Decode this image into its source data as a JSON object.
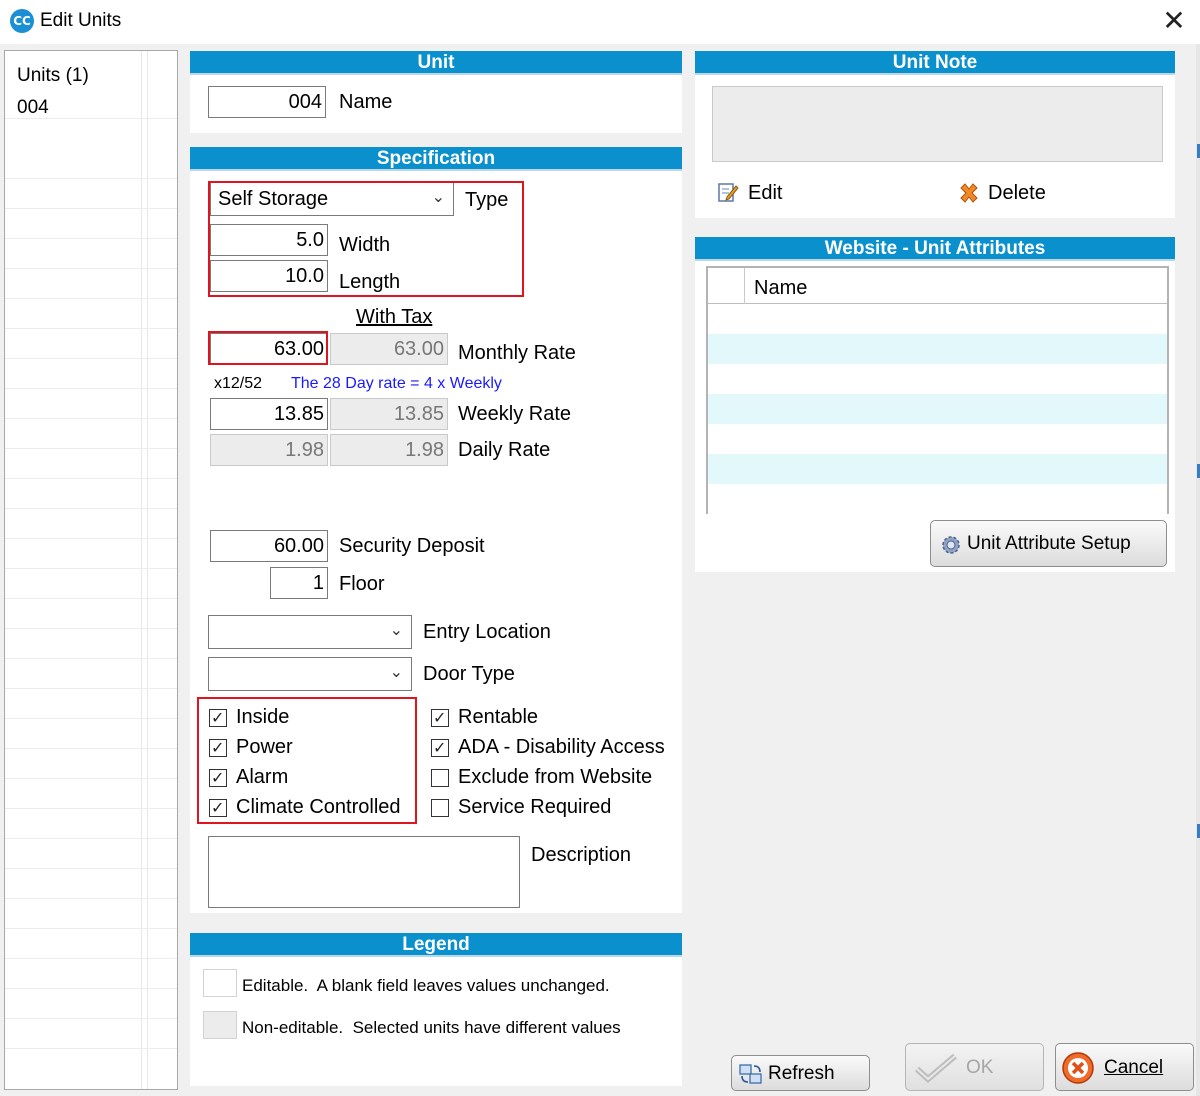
{
  "window": {
    "title": "Edit Units",
    "app_icon_text": "CC"
  },
  "units_list": {
    "header": "Units (1)",
    "items": [
      "004"
    ]
  },
  "unit_panel": {
    "title": "Unit",
    "name_value": "004",
    "name_label": "Name"
  },
  "specification": {
    "title": "Specification",
    "type_value": "Self Storage",
    "type_label": "Type",
    "width_value": "5.0",
    "width_label": "Width",
    "length_value": "10.0",
    "length_label": "Length",
    "with_tax_header": "With Tax",
    "monthly_rate_value": "63.00",
    "monthly_rate_tax_value": "63.00",
    "monthly_rate_label": "Monthly Rate",
    "multiplier_text": "x12/52",
    "day_rate_note": "The 28 Day rate = 4 x Weekly",
    "weekly_rate_value": "13.85",
    "weekly_rate_tax_value": "13.85",
    "weekly_rate_label": "Weekly Rate",
    "daily_rate_value": "1.98",
    "daily_rate_tax_value": "1.98",
    "daily_rate_label": "Daily Rate",
    "security_deposit_value": "60.00",
    "security_deposit_label": "Security Deposit",
    "floor_value": "1",
    "floor_label": "Floor",
    "entry_location_value": "",
    "entry_location_label": "Entry Location",
    "door_type_value": "",
    "door_type_label": "Door Type",
    "checkboxes_left": [
      {
        "label": "Inside",
        "checked": true
      },
      {
        "label": "Power",
        "checked": true
      },
      {
        "label": "Alarm",
        "checked": true
      },
      {
        "label": "Climate Controlled",
        "checked": true
      }
    ],
    "checkboxes_right": [
      {
        "label": "Rentable",
        "checked": true
      },
      {
        "label": "ADA - Disability Access",
        "checked": true
      },
      {
        "label": "Exclude from Website",
        "checked": false
      },
      {
        "label": "Service Required",
        "checked": false
      }
    ],
    "description_value": "",
    "description_label": "Description"
  },
  "legend": {
    "title": "Legend",
    "editable_text": "Editable.  A blank field leaves values unchanged.",
    "noneditable_text": "Non-editable.  Selected units have different values"
  },
  "unit_note": {
    "title": "Unit Note",
    "note_value": "",
    "edit_label": "Edit",
    "delete_label": "Delete"
  },
  "website_attributes": {
    "title": "Website - Unit Attributes",
    "column_name": "Name",
    "rows": [
      "",
      "",
      "",
      "",
      "",
      "",
      ""
    ],
    "setup_button": "Unit Attribute Setup"
  },
  "footer": {
    "refresh_label": "Refresh",
    "ok_label": "OK",
    "cancel_label": "Cancel"
  },
  "colors": {
    "header_blue": "#0a90cc",
    "highlight_red": "#e0141e",
    "grid_alt_row": "#e3f8fa",
    "note_blue": "#1a1aff"
  }
}
